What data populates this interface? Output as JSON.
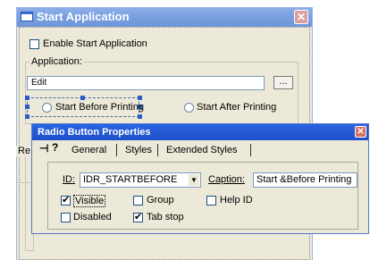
{
  "start_app": {
    "title": "Start Application",
    "close": "✕",
    "enable_label": "Enable Start Application",
    "enable_checked": false,
    "application_group": "Application:",
    "app_value": "Edit",
    "browse_label": "...",
    "radio_before": "Start Before Printing",
    "radio_after": "Start After Printing",
    "second_group": "Re"
  },
  "rbp": {
    "title": "Radio Button Properties",
    "close": "✕",
    "pin_icon": "⊣",
    "help_icon": "?",
    "tabs": [
      "General",
      "Styles",
      "Extended Styles"
    ],
    "id_label": "ID:",
    "id_value": "IDR_STARTBEFORE",
    "caption_label": "Caption:",
    "caption_value": "Start &Before Printing",
    "checks": [
      {
        "label": "Visible",
        "checked": true
      },
      {
        "label": "Group",
        "checked": false
      },
      {
        "label": "Help ID",
        "checked": false
      },
      {
        "label": "Disabled",
        "checked": false
      },
      {
        "label": "Tab stop",
        "checked": true
      }
    ]
  }
}
